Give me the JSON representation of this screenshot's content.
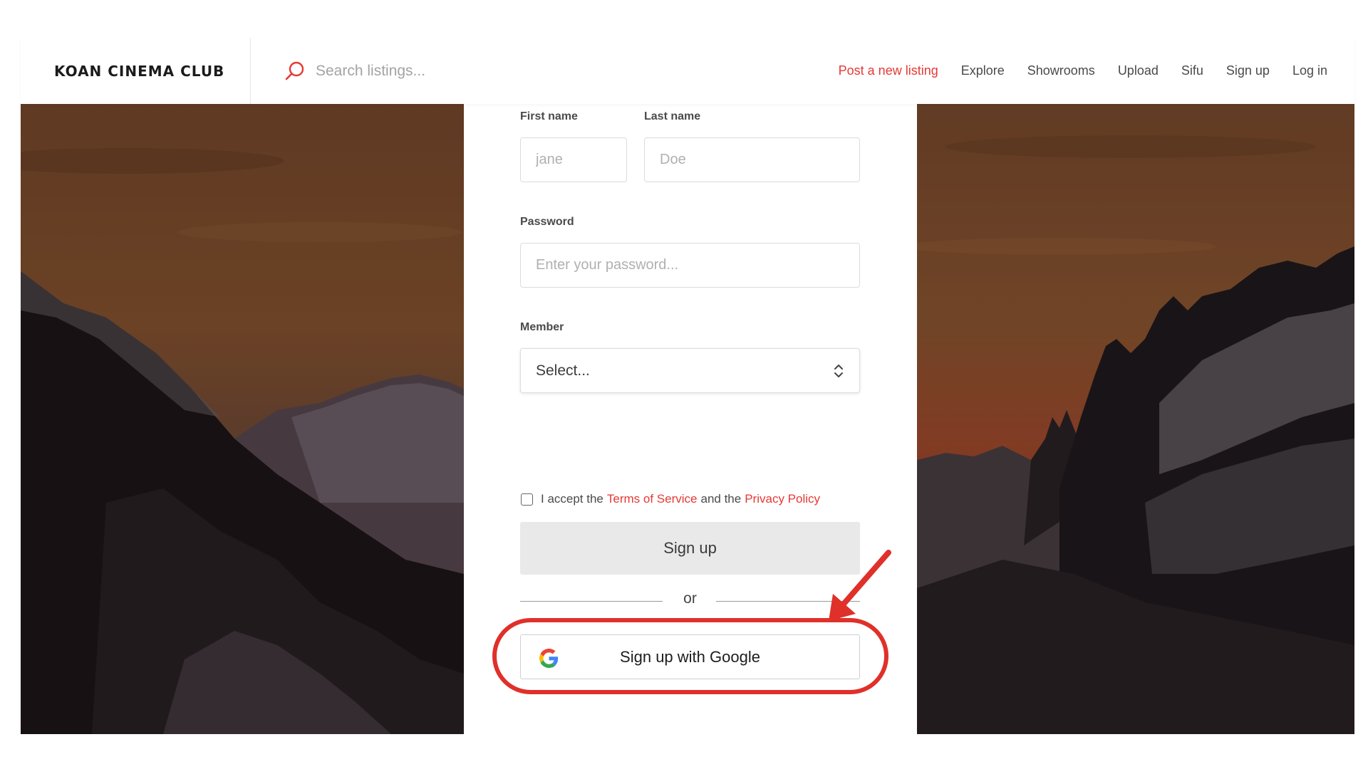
{
  "header": {
    "logo": "KOAN CINEMA CLUB",
    "search_placeholder": "Search listings...",
    "nav": {
      "post_listing": "Post a new listing",
      "explore": "Explore",
      "showrooms": "Showrooms",
      "upload": "Upload",
      "sifu": "Sifu",
      "sign_up": "Sign up",
      "log_in": "Log in"
    },
    "accent_color": "#e53935"
  },
  "form": {
    "first_name_label": "First name",
    "first_name_placeholder": "jane",
    "last_name_label": "Last name",
    "last_name_placeholder": "Doe",
    "password_label": "Password",
    "password_placeholder": "Enter your password...",
    "member_label": "Member",
    "member_value": "Select...",
    "terms": {
      "prefix": "I accept the",
      "terms_link": "Terms of Service",
      "middle": "and the",
      "privacy_link": "Privacy Policy"
    },
    "signup_button": "Sign up",
    "or_text": "or",
    "google_button": "Sign up with Google"
  },
  "icons": [
    "search-icon",
    "chevron-updown-icon",
    "google-icon",
    "checkbox"
  ],
  "annotation": {
    "highlight_color": "#e0302a",
    "highlight_target": "google-signup-button"
  }
}
